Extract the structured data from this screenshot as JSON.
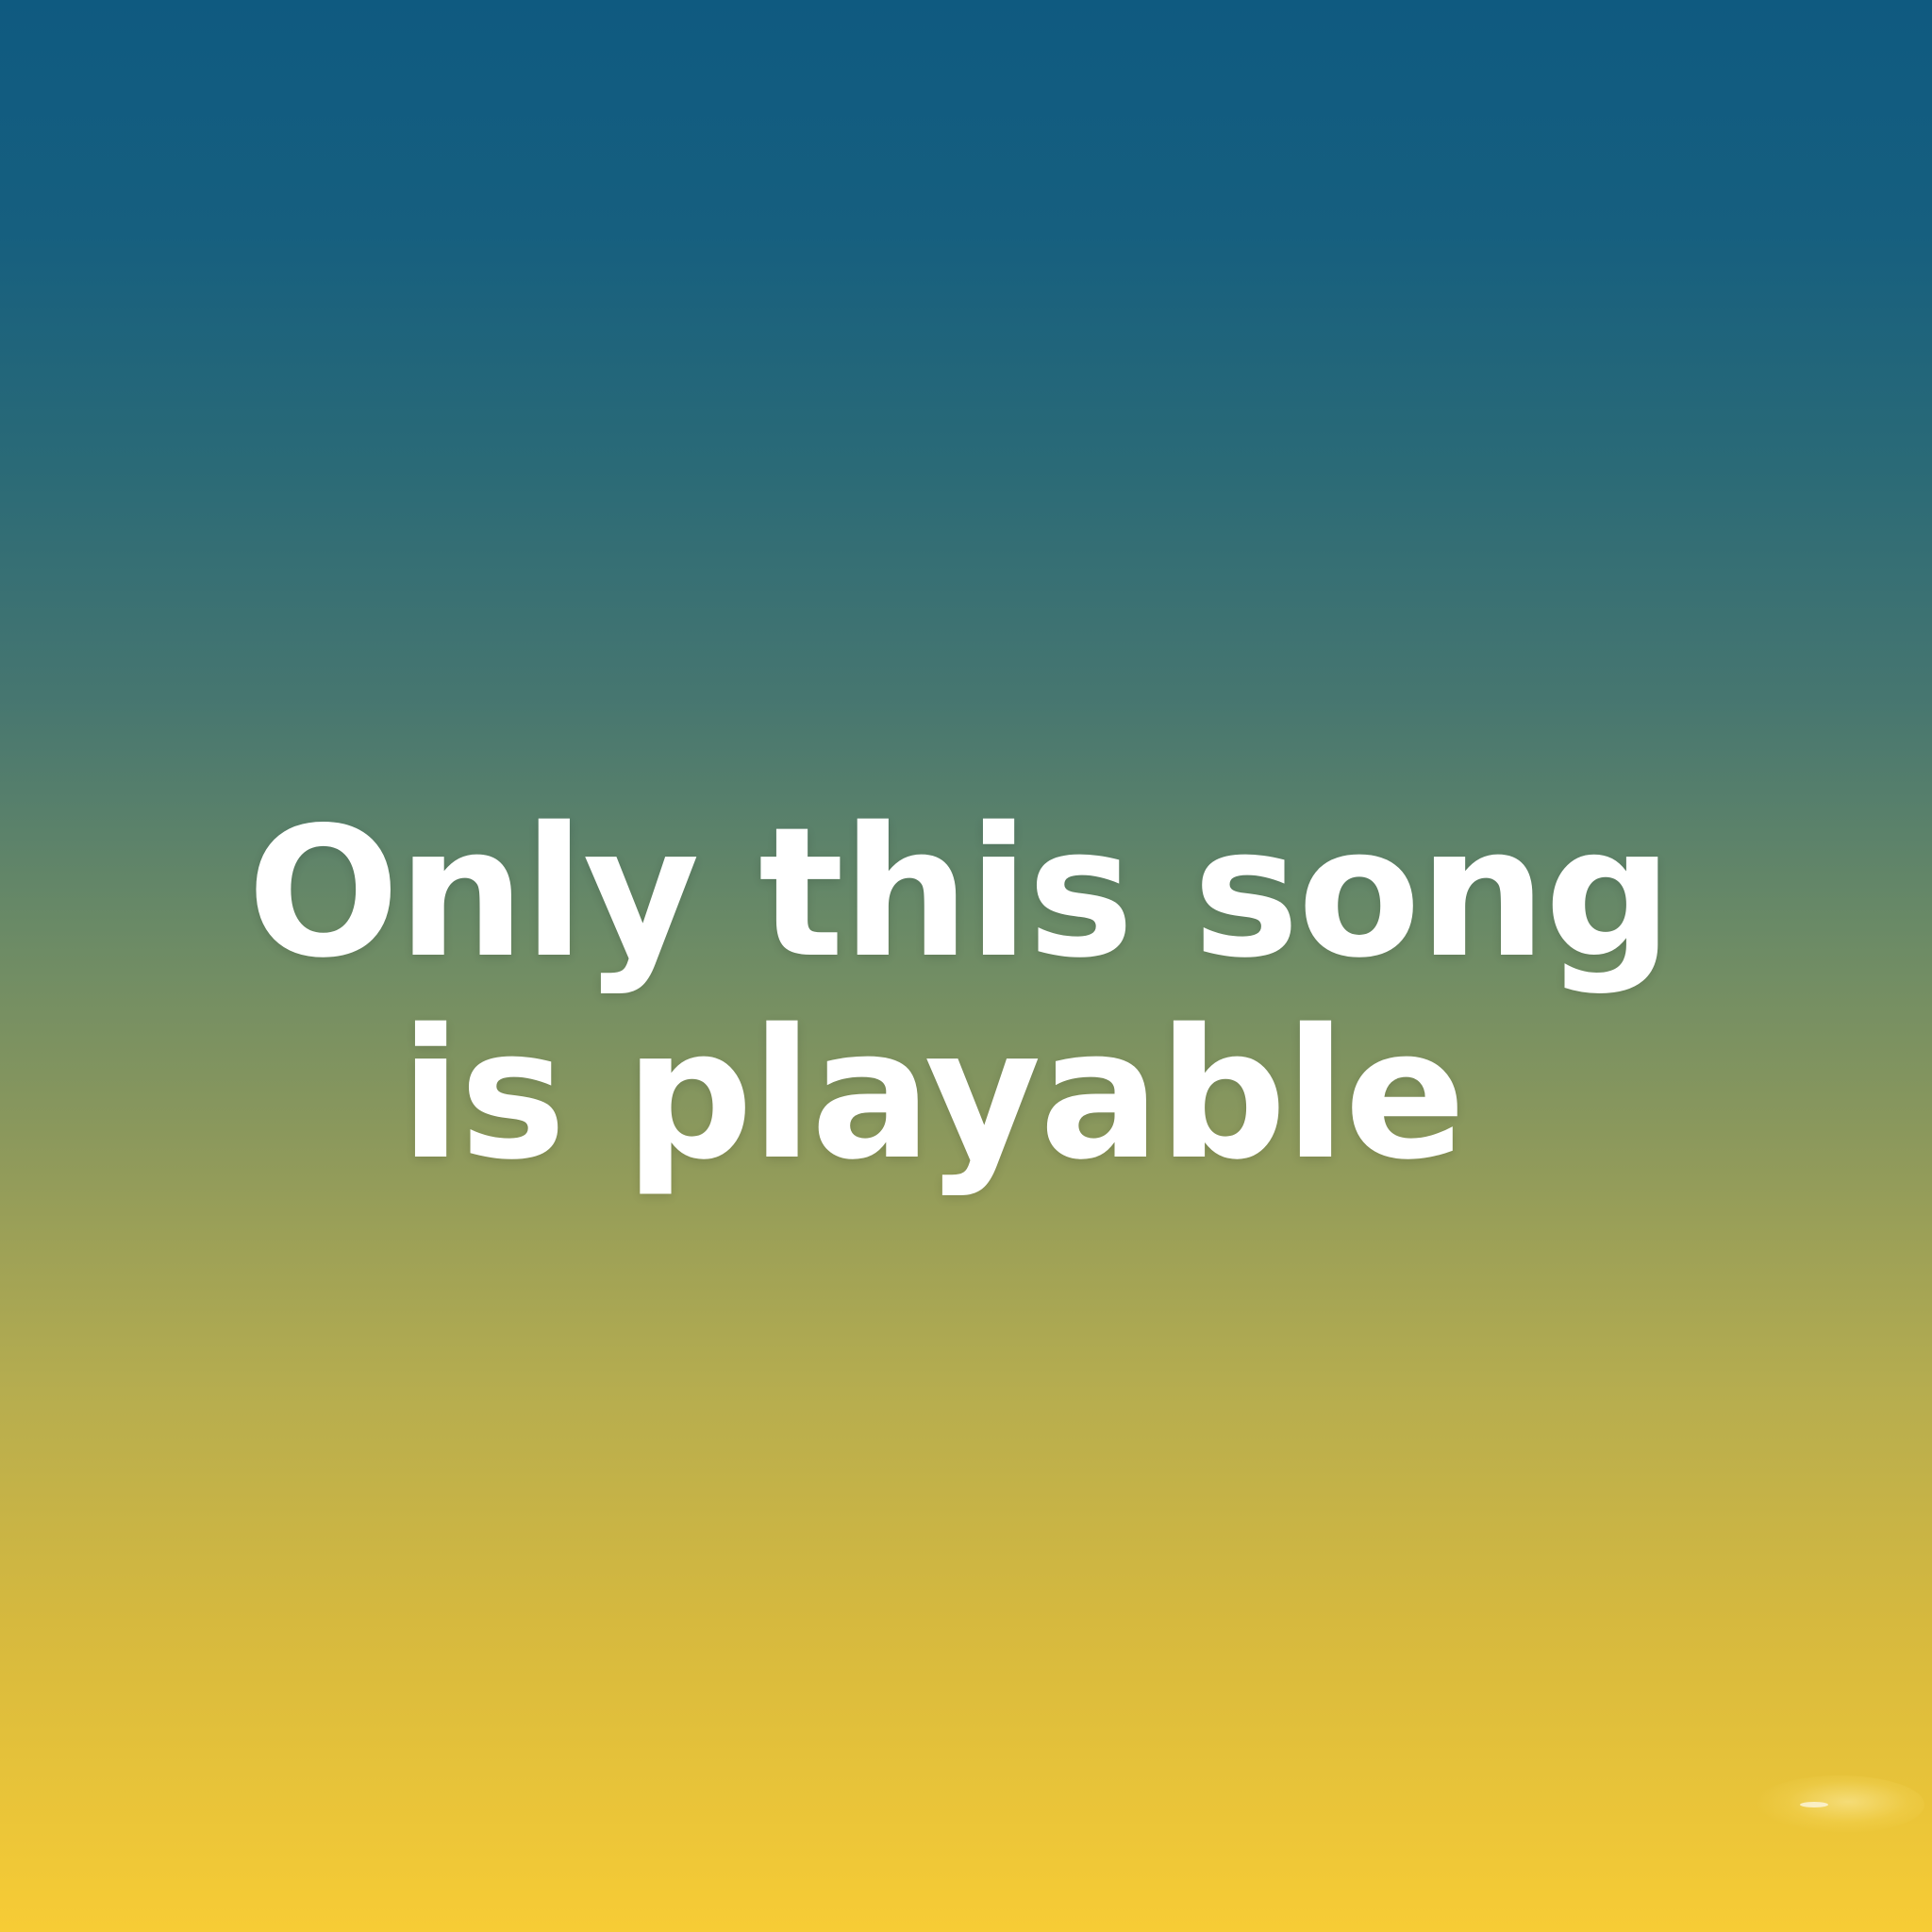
{
  "message": {
    "line1": "Only this song",
    "line2": "is playable"
  },
  "colors": {
    "gradient_top": "#0f5a80",
    "gradient_bottom": "#f7cc35",
    "text": "#ffffff"
  }
}
